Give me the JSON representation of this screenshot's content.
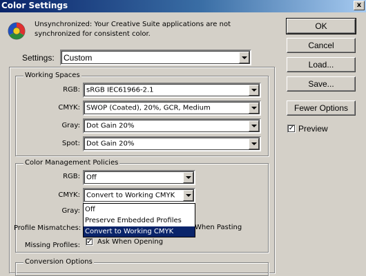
{
  "window": {
    "title": "Color Settings",
    "close_glyph": "x"
  },
  "notice": {
    "text_line1": "Unsynchronized: Your Creative Suite applications are not",
    "text_line2": "synchronized for consistent color.",
    "icon": "color-sync-warning-icon"
  },
  "settings": {
    "label": "Settings:",
    "value": "Custom"
  },
  "working_spaces": {
    "title": "Working Spaces",
    "rgb": {
      "label": "RGB:",
      "value": "sRGB IEC61966-2.1"
    },
    "cmyk": {
      "label": "CMYK:",
      "value": "SWOP (Coated), 20%, GCR, Medium"
    },
    "gray": {
      "label": "Gray:",
      "value": "Dot Gain 20%"
    },
    "spot": {
      "label": "Spot:",
      "value": "Dot Gain 20%"
    }
  },
  "policies": {
    "title": "Color Management Policies",
    "rgb": {
      "label": "RGB:",
      "value": "Off"
    },
    "cmyk": {
      "label": "CMYK:",
      "value": "Convert to Working CMYK"
    },
    "gray": {
      "label": "Gray:"
    },
    "profile_mismatches": {
      "label": "Profile Mismatches:",
      "paste_partial": "When Pasting"
    },
    "missing_profiles": {
      "label": "Missing Profiles:",
      "ask_label": "Ask When Opening",
      "ask_checked": true
    },
    "cmyk_options": [
      "Off",
      "Preserve Embedded Profiles",
      "Convert to Working CMYK"
    ],
    "cmyk_selected": "Convert to Working CMYK"
  },
  "conversion": {
    "title": "Conversion Options"
  },
  "buttons": {
    "ok": "OK",
    "cancel": "Cancel",
    "load": "Load...",
    "save": "Save...",
    "fewer_options": "Fewer Options"
  },
  "preview": {
    "label": "Preview",
    "checked": true,
    "check_glyph": "✓"
  },
  "colors": {
    "selection": "#0a246a",
    "dialog_bg": "#d4d0c8",
    "title_start": "#0a246a"
  }
}
